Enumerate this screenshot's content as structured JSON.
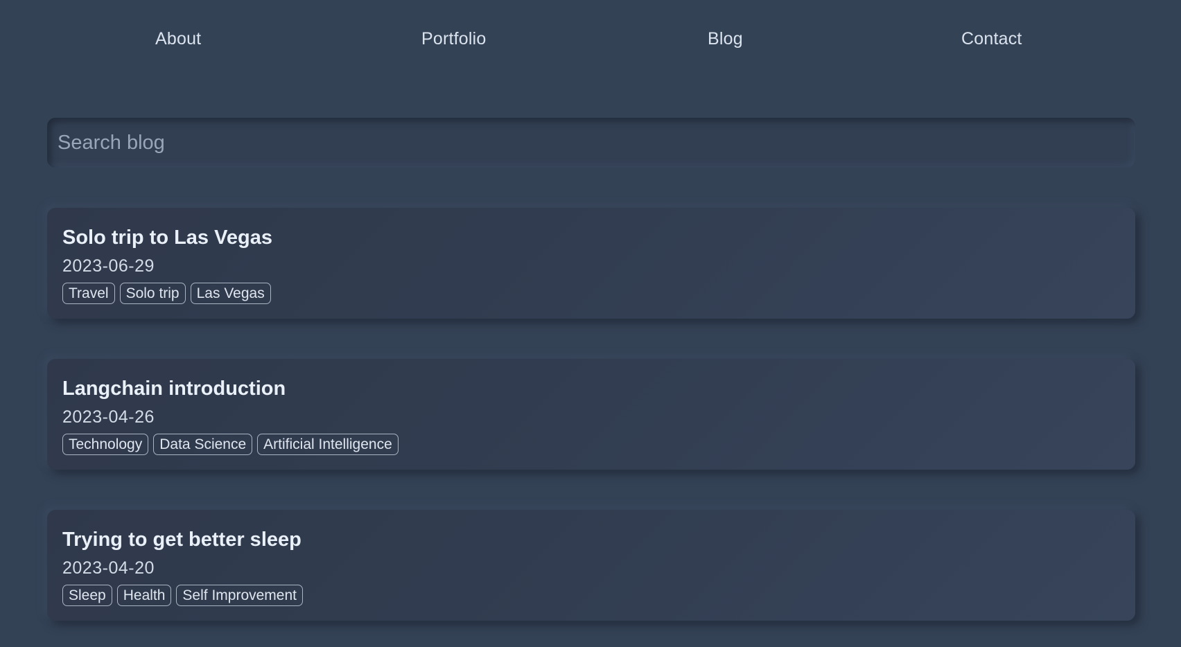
{
  "nav": {
    "items": [
      {
        "label": "About"
      },
      {
        "label": "Portfolio"
      },
      {
        "label": "Blog"
      },
      {
        "label": "Contact"
      }
    ]
  },
  "search": {
    "placeholder": "Search blog",
    "value": ""
  },
  "posts": [
    {
      "title": "Solo trip to Las Vegas",
      "date": "2023-06-29",
      "tags": [
        "Travel",
        "Solo trip",
        "Las Vegas"
      ]
    },
    {
      "title": "Langchain introduction",
      "date": "2023-04-26",
      "tags": [
        "Technology",
        "Data Science",
        "Artificial Intelligence"
      ]
    },
    {
      "title": "Trying to get better sleep",
      "date": "2023-04-20",
      "tags": [
        "Sleep",
        "Health",
        "Self Improvement"
      ]
    }
  ],
  "colors": {
    "background": "#344256",
    "card": "#323d51",
    "text": "#e2e8f0",
    "tag_border": "#aab4c2"
  }
}
